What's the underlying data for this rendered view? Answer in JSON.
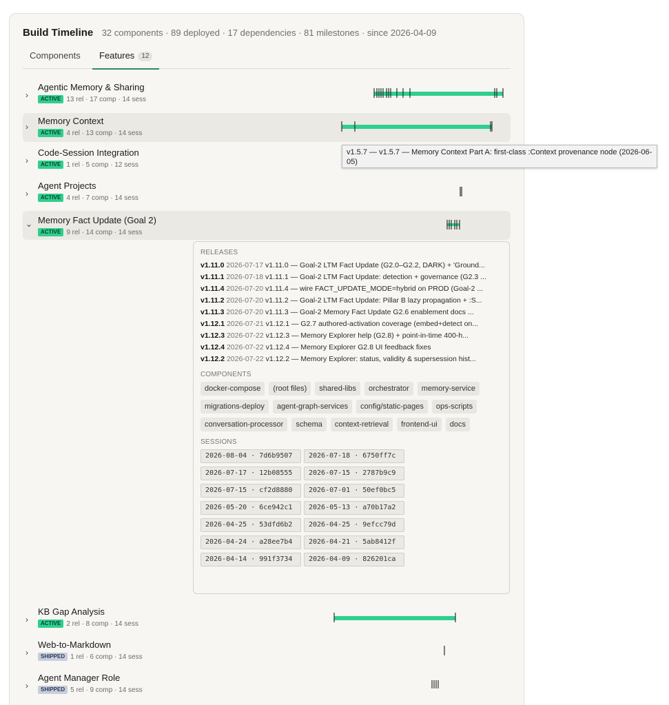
{
  "header": {
    "title": "Build Timeline",
    "summary": "32 components · 89 deployed · 17 dependencies · 81 milestones · since 2026-04-09"
  },
  "tabs": [
    {
      "label": "Components"
    },
    {
      "label": "Features",
      "count": "12"
    }
  ],
  "features": [
    {
      "name": "Agentic Memory & Sharing",
      "status": "ACTIVE",
      "meta": "13 rel · 17 comp · 14 sess",
      "expanded": false
    },
    {
      "name": "Memory Context",
      "status": "ACTIVE",
      "meta": "4 rel · 13 comp · 14 sess",
      "expanded": false
    },
    {
      "name": "Code-Session Integration",
      "status": "ACTIVE",
      "meta": "1 rel · 5 comp · 12 sess",
      "expanded": false
    },
    {
      "name": "Agent Projects",
      "status": "ACTIVE",
      "meta": "4 rel · 7 comp · 14 sess",
      "expanded": false
    },
    {
      "name": "Memory Fact Update (Goal 2)",
      "status": "ACTIVE",
      "meta": "9 rel · 14 comp · 14 sess",
      "expanded": true
    },
    {
      "name": "KB Gap Analysis",
      "status": "ACTIVE",
      "meta": "2 rel · 8 comp · 14 sess",
      "expanded": false
    },
    {
      "name": "Web-to-Markdown",
      "status": "SHIPPED",
      "meta": "1 rel · 6 comp · 14 sess",
      "expanded": false
    },
    {
      "name": "Agent Manager Role",
      "status": "SHIPPED",
      "meta": "5 rel · 9 comp · 14 sess",
      "expanded": false
    }
  ],
  "detail": {
    "releases_label": "RELEASES",
    "releases": [
      {
        "version": "v1.11.0",
        "date": "2026-07-17",
        "text": "v1.11.0 — Goal-2 LTM Fact Update (G2.0–G2.2, DARK) + 'Ground..."
      },
      {
        "version": "v1.11.1",
        "date": "2026-07-18",
        "text": "v1.11.1 — Goal-2 LTM Fact Update: detection + governance (G2.3 ..."
      },
      {
        "version": "v1.11.4",
        "date": "2026-07-20",
        "text": "v1.11.4 — wire FACT_UPDATE_MODE=hybrid on PROD (Goal-2 ..."
      },
      {
        "version": "v1.11.2",
        "date": "2026-07-20",
        "text": "v1.11.2 — Goal-2 LTM Fact Update: Pillar B lazy propagation + :S..."
      },
      {
        "version": "v1.11.3",
        "date": "2026-07-20",
        "text": "v1.11.3 — Goal-2 Memory Fact Update G2.6 enablement docs ..."
      },
      {
        "version": "v1.12.1",
        "date": "2026-07-21",
        "text": "v1.12.1 — G2.7 authored-activation coverage (embed+detect on..."
      },
      {
        "version": "v1.12.3",
        "date": "2026-07-22",
        "text": "v1.12.3 — Memory Explorer help (G2.8) + point-in-time 400-h..."
      },
      {
        "version": "v1.12.4",
        "date": "2026-07-22",
        "text": "v1.12.4 — Memory Explorer G2.8 UI feedback fixes"
      },
      {
        "version": "v1.12.2",
        "date": "2026-07-22",
        "text": "v1.12.2 — Memory Explorer: status, validity & supersession hist..."
      }
    ],
    "components_label": "COMPONENTS",
    "components": [
      "docker-compose",
      "(root files)",
      "shared-libs",
      "orchestrator",
      "memory-service",
      "migrations-deploy",
      "agent-graph-services",
      "config/static-pages",
      "ops-scripts",
      "conversation-processor",
      "schema",
      "context-retrieval",
      "frontend-ui",
      "docs"
    ],
    "sessions_label": "SESSIONS",
    "sessions": [
      "2026-08-04 · 7d6b9507",
      "2026-07-18 · 6750ff7c",
      "2026-07-17 · 12b08555",
      "2026-07-15 · 2787b9c9",
      "2026-07-15 · cf2d8880",
      "2026-07-01 · 50ef0bc5",
      "2026-05-20 · 6ce942c1",
      "2026-05-13 · a70b17a2",
      "2026-04-25 · 53dfd6b2",
      "2026-04-25 · 9efcc79d",
      "2026-04-24 · a28ee7b4",
      "2026-04-21 · 5ab8412f",
      "2026-04-14 · 991f3734",
      "2026-04-09 · 826201ca"
    ]
  },
  "tooltip": {
    "text": "v1.5.7 — v1.5.7 — Memory Context Part A: first-class :Context provenance node (2026-06-05)"
  },
  "colors": {
    "active_bar": "#2fcf8e",
    "tick": "#2b2b2b",
    "badge_active": "#2fcf8e",
    "badge_shipped": "#c7cedd",
    "tab_underline": "#2a8a66"
  }
}
